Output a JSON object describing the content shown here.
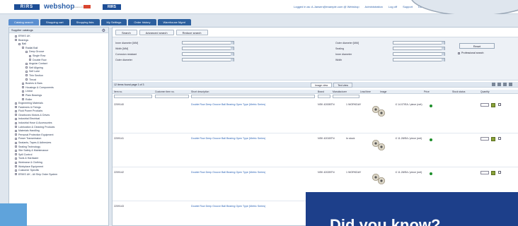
{
  "header": {
    "logo_text": "RIRS",
    "brand": "webshop",
    "brand_sub": "powered by",
    "logo2_text": "RIRS",
    "links": [
      "Logged in as: A.Jansen@example.com @ Webshop",
      "Administration",
      "Log off",
      "Support",
      "Download"
    ]
  },
  "tabs": [
    "Catalog search",
    "Shopping cart",
    "Shopping lists",
    "My Settings",
    "Order history",
    "Warehouse Mgmt"
  ],
  "tabs_active": 0,
  "left_panel": {
    "title": "Supplier catalogs",
    "tree": [
      "ERIKS UK",
      "Bearings",
      "Ball",
      "Radial Ball",
      "Deep Groove",
      "Single Row",
      "Double Row",
      "Angular Contact",
      "Self Aligning",
      "Self Lube",
      "Thin Section",
      "Thrust",
      "Bushes & Bars",
      "Housings & Components",
      "Linear",
      "Plain Bearings",
      "Roller",
      "Engineering Materials",
      "Fasteners & Fixings",
      "Fluid Power Products",
      "Gearboxes Motors & Drives",
      "Industrial Electrical",
      "Industrial Hose & Accessories",
      "Lubrication & Cleaning Products",
      "Materials Handling",
      "Personal Protection Equipment",
      "Power Transmission",
      "Sealants, Tapes & Adhesives",
      "Sealing Technology",
      "Site Safety & Maintenance",
      "Spill Control",
      "Tools & Hardware",
      "Workwear & Clothing",
      "Workplace Equipment",
      "Customer Specific",
      "ERIKS UK - All Ship Order System"
    ]
  },
  "search_buttons": [
    "Search",
    "Advanced search",
    "Reduce search"
  ],
  "form": {
    "left_labels": [
      "Inner diameter [MM]",
      "Width [MM]",
      "Corrosion resistant",
      "Outer diameter"
    ],
    "right_labels": [
      "Outer diameter [MM]",
      "Sealing",
      "Inner diameter",
      "Width"
    ],
    "reset_label": "Reset",
    "professional_label": "Professional search"
  },
  "results": {
    "count_text": "12 items found   page 1 of 3",
    "view_tabs": [
      "Image view",
      "Text view"
    ],
    "columns": [
      "Item no.",
      "Customer item no.",
      "Short description",
      "Brand",
      "Manufacturer",
      "Lead time",
      "Image",
      "Price",
      "Stock status",
      "Quantity"
    ],
    "rows": [
      {
        "item_no": "2209140",
        "desc": "Double Row Deep Groove Ball Bearing Open Type (Metric Series)",
        "mfr": "NSK 4200BTN",
        "lead": "1 WORKDAY",
        "price": "£ 14.07/EA / piece (net)"
      },
      {
        "item_no": "2209141",
        "desc": "Double Row Deep Groove Ball Bearing Open Type (Metric Series)",
        "mfr": "NSK 4201BTN",
        "lead": "In stock",
        "price": "£ 11.28/EA / piece (net)"
      },
      {
        "item_no": "2209142",
        "desc": "Double Row Deep Groove Ball Bearing Open Type (Metric Series)",
        "mfr": "NSK 4202BTN",
        "lead": "1 WORKDAY",
        "price": "£ 11.28/EA / piece (net)"
      },
      {
        "item_no": "2209143",
        "desc": "Double Row Deep Groove Ball Bearing Open Type (Metric Series)",
        "mfr": "NSK 4203BTN",
        "lead": "",
        "price": ""
      }
    ]
  },
  "callout": {
    "text": "Did you know?"
  },
  "colors": {
    "primary": "#1d4e96",
    "callout_bg": "#1d3f8a",
    "accent": "#5fa3db",
    "stock_ok": "#1e8f2c"
  }
}
